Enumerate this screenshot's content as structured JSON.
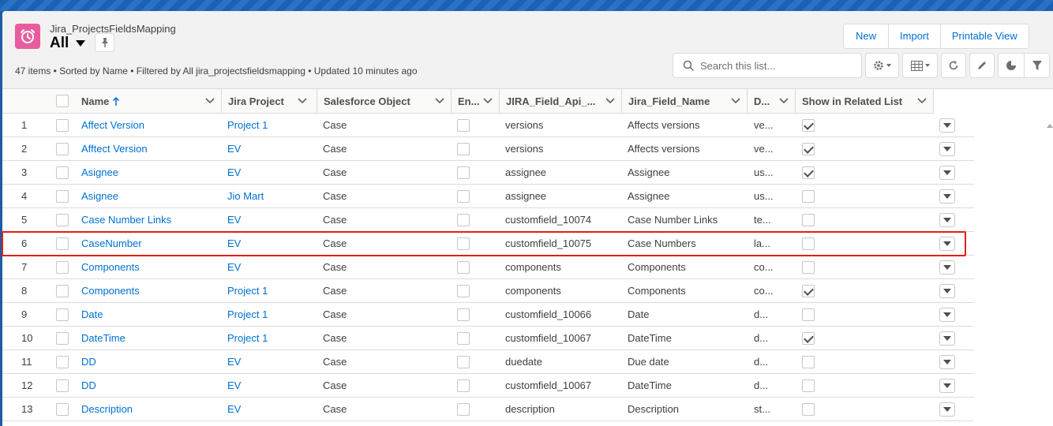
{
  "header": {
    "object_name": "Jira_ProjectsFieldsMapping",
    "list_view_name": "All",
    "status_line": "47 items • Sorted by Name • Filtered by All jira_projectsfieldsmapping • Updated 10 minutes ago",
    "buttons": [
      "New",
      "Import",
      "Printable View"
    ],
    "search_placeholder": "Search this list..."
  },
  "table": {
    "columns": [
      {
        "key": "name",
        "label": "Name",
        "sort": "asc"
      },
      {
        "key": "jira_project",
        "label": "Jira Project"
      },
      {
        "key": "salesforce_object",
        "label": "Salesforce Object"
      },
      {
        "key": "enabled",
        "label": "En..."
      },
      {
        "key": "jira_field_api",
        "label": "JIRA_Field_Api_..."
      },
      {
        "key": "jira_field_name",
        "label": "Jira_Field_Name"
      },
      {
        "key": "d",
        "label": "D..."
      },
      {
        "key": "show_related",
        "label": "Show in Related List"
      }
    ],
    "rows": [
      {
        "num": "1",
        "name": "Affect Version",
        "project": "Project 1",
        "object": "Case",
        "enabled": false,
        "api": "versions",
        "field_name": "Affects versions",
        "d": "ve...",
        "show": true
      },
      {
        "num": "2",
        "name": "Afftect Version",
        "project": "EV",
        "object": "Case",
        "enabled": false,
        "api": "versions",
        "field_name": "Affects versions",
        "d": "ve...",
        "show": true
      },
      {
        "num": "3",
        "name": "Asignee",
        "project": "EV",
        "object": "Case",
        "enabled": false,
        "api": "assignee",
        "field_name": "Assignee",
        "d": "us...",
        "show": true
      },
      {
        "num": "4",
        "name": "Asignee",
        "project": "Jio Mart",
        "object": "Case",
        "enabled": false,
        "api": "assignee",
        "field_name": "Assignee",
        "d": "us...",
        "show": false
      },
      {
        "num": "5",
        "name": "Case Number Links",
        "project": "EV",
        "object": "Case",
        "enabled": false,
        "api": "customfield_10074",
        "field_name": "Case Number Links",
        "d": "te...",
        "show": false
      },
      {
        "num": "6",
        "name": "CaseNumber",
        "project": "EV",
        "object": "Case",
        "enabled": false,
        "api": "customfield_10075",
        "field_name": "Case Numbers",
        "d": "la...",
        "show": false
      },
      {
        "num": "7",
        "name": "Components",
        "project": "EV",
        "object": "Case",
        "enabled": false,
        "api": "components",
        "field_name": "Components",
        "d": "co...",
        "show": false
      },
      {
        "num": "8",
        "name": "Components",
        "project": "Project 1",
        "object": "Case",
        "enabled": false,
        "api": "components",
        "field_name": "Components",
        "d": "co...",
        "show": true
      },
      {
        "num": "9",
        "name": "Date",
        "project": "Project 1",
        "object": "Case",
        "enabled": false,
        "api": "customfield_10066",
        "field_name": "Date",
        "d": "d...",
        "show": false
      },
      {
        "num": "10",
        "name": "DateTime",
        "project": "Project 1",
        "object": "Case",
        "enabled": false,
        "api": "customfield_10067",
        "field_name": "DateTime",
        "d": "d...",
        "show": true
      },
      {
        "num": "11",
        "name": "DD",
        "project": "EV",
        "object": "Case",
        "enabled": false,
        "api": "duedate",
        "field_name": "Due date",
        "d": "d...",
        "show": false
      },
      {
        "num": "12",
        "name": "DD",
        "project": "EV",
        "object": "Case",
        "enabled": false,
        "api": "customfield_10067",
        "field_name": "DateTime",
        "d": "d...",
        "show": false
      },
      {
        "num": "13",
        "name": "Description",
        "project": "EV",
        "object": "Case",
        "enabled": false,
        "api": "description",
        "field_name": "Description",
        "d": "st...",
        "show": false
      }
    ],
    "highlighted_row": "6"
  },
  "colors": {
    "link": "#0070d2",
    "app_icon": "#e85c9f",
    "highlight": "#e0201b"
  },
  "icons": [
    "alarm-clock-icon",
    "pin-icon",
    "search-icon",
    "gear-icon",
    "table-icon",
    "refresh-icon",
    "pencil-icon",
    "pie-chart-icon",
    "filter-icon"
  ]
}
